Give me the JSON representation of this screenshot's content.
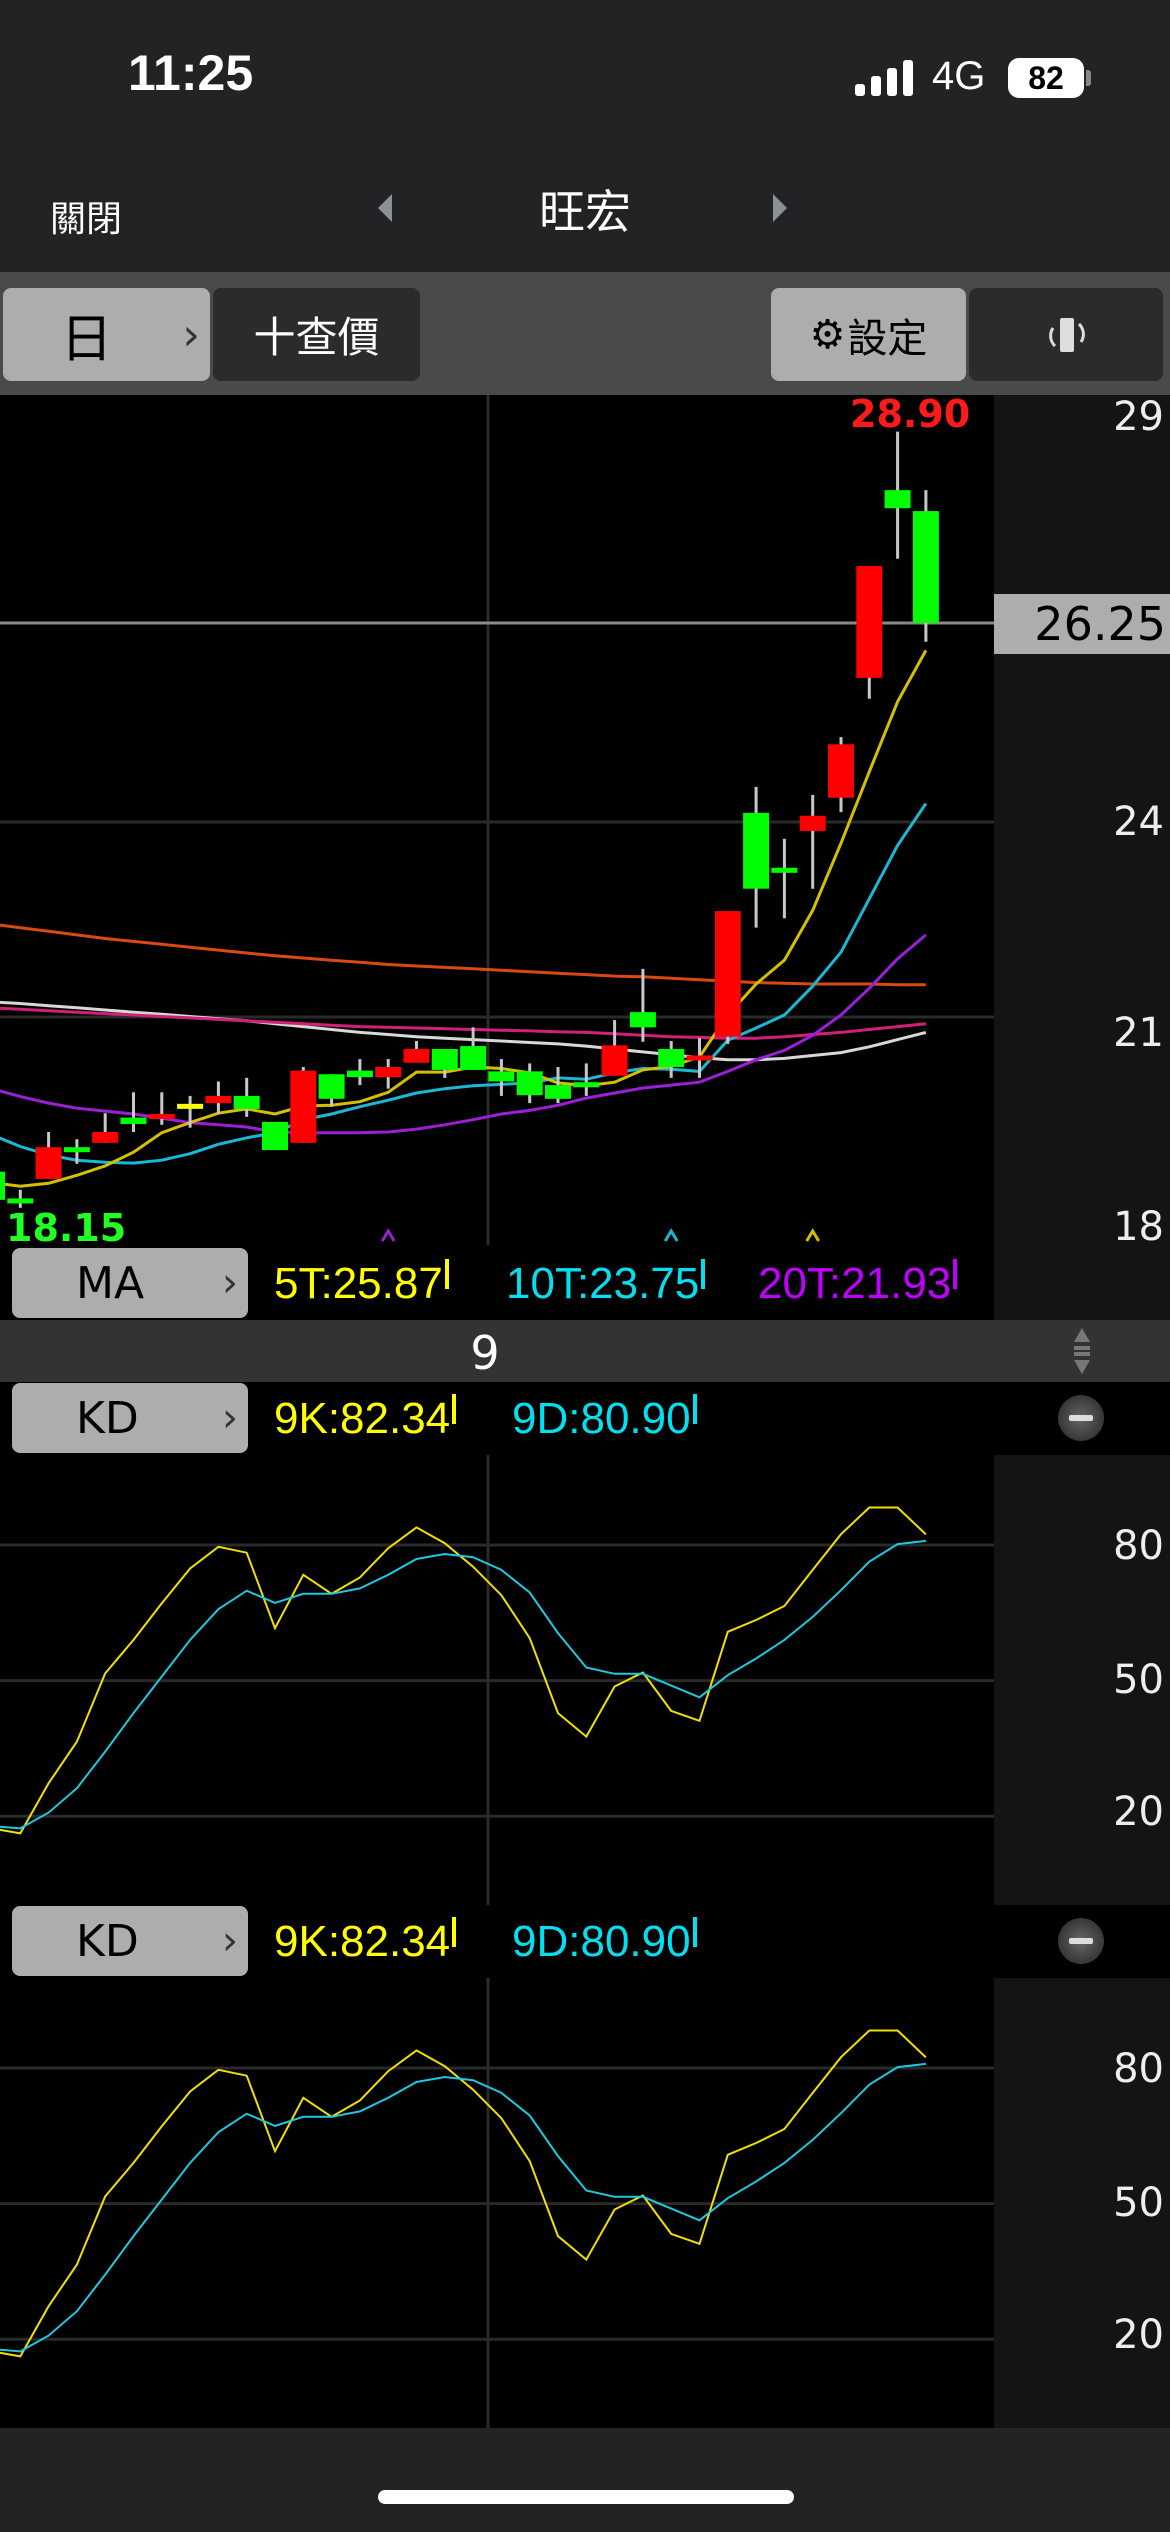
{
  "status_bar": {
    "time": "11:25",
    "network": "4G",
    "battery": "82"
  },
  "nav": {
    "close_label": "關閉",
    "title": "旺宏"
  },
  "toolbar": {
    "period_label": "日",
    "quote_label": "十查價",
    "settings_label": "設定"
  },
  "price_chart": {
    "high_label": "28.90",
    "low_label": "18.15",
    "current_price": "26.25",
    "axis_labels": [
      "29",
      "24",
      "21",
      "18"
    ]
  },
  "ma_row": {
    "button_label": "MA",
    "ma5": "5T:25.87",
    "ma10": "10T:23.75",
    "ma20": "20T:21.93"
  },
  "param_row": {
    "value": "9"
  },
  "kd_rows": [
    {
      "button_label": "KD",
      "k": "9K:82.34",
      "d": "9D:80.90",
      "axis_labels": [
        "80",
        "50",
        "20"
      ]
    },
    {
      "button_label": "KD",
      "k": "9K:82.34",
      "d": "9D:80.90",
      "axis_labels": [
        "80",
        "50",
        "20"
      ]
    }
  ],
  "colors": {
    "up": "#ff0000",
    "down": "#00ff00",
    "flat": "#ffff00",
    "ma5": "#d4c000",
    "ma10": "#1ab8d4",
    "ma20": "#9b1fd6",
    "ma60": "#d0207a",
    "ma120": "#d8d8d8",
    "ma240": "#d84a10",
    "k": "#f0e000",
    "d": "#1ec8e0"
  },
  "chart_data": [
    {
      "type": "candlestick",
      "ohlc": [
        [
          18.65,
          18.7,
          18.2,
          18.26
        ],
        [
          18.28,
          18.4,
          18.15,
          18.26
        ],
        [
          18.55,
          19.2,
          18.55,
          18.99
        ],
        [
          18.99,
          19.1,
          18.76,
          18.97
        ],
        [
          19.05,
          19.46,
          19.05,
          19.2
        ],
        [
          19.4,
          19.75,
          19.2,
          19.31
        ],
        [
          19.41,
          19.75,
          19.3,
          19.45
        ],
        [
          19.59,
          19.7,
          19.26,
          19.59
        ],
        [
          19.6,
          19.9,
          19.45,
          19.7
        ],
        [
          19.7,
          19.95,
          19.41,
          19.52
        ],
        [
          19.34,
          19.34,
          18.95,
          18.95
        ],
        [
          19.05,
          20.1,
          19.05,
          20.05
        ],
        [
          20.0,
          20.0,
          19.55,
          19.66
        ],
        [
          20.05,
          20.21,
          19.85,
          19.96
        ],
        [
          19.96,
          20.21,
          19.8,
          20.1
        ],
        [
          20.16,
          20.46,
          20.16,
          20.35
        ],
        [
          20.35,
          20.35,
          19.95,
          20.06
        ],
        [
          20.39,
          20.65,
          20.06,
          20.06
        ],
        [
          20.04,
          20.21,
          19.7,
          19.9
        ],
        [
          20.04,
          20.15,
          19.6,
          19.71
        ],
        [
          19.85,
          20.1,
          19.6,
          19.66
        ],
        [
          19.89,
          20.15,
          19.7,
          19.82
        ],
        [
          19.98,
          20.75,
          19.98,
          20.4
        ],
        [
          20.86,
          21.46,
          20.45,
          20.65
        ],
        [
          20.35,
          20.46,
          19.95,
          20.1
        ],
        [
          20.2,
          20.5,
          19.95,
          20.26
        ],
        [
          20.52,
          22.26,
          20.42,
          22.26
        ],
        [
          23.62,
          23.98,
          22.03,
          22.57
        ],
        [
          22.86,
          23.26,
          22.16,
          22.79
        ],
        [
          23.37,
          23.87,
          22.57,
          23.58
        ],
        [
          23.83,
          24.67,
          23.63,
          24.57
        ],
        [
          25.49,
          27.04,
          25.2,
          27.04
        ],
        [
          28.09,
          28.9,
          27.14,
          27.84
        ],
        [
          27.8,
          28.09,
          25.99,
          26.25
        ]
      ],
      "ma": {
        "ma5": [
          18.5,
          18.45,
          18.49,
          18.6,
          18.73,
          18.92,
          19.19,
          19.33,
          19.46,
          19.52,
          19.45,
          19.56,
          19.57,
          19.62,
          19.75,
          20.03,
          20.03,
          20.1,
          20.08,
          20.02,
          19.88,
          19.84,
          19.89,
          20.06,
          20.11,
          20.24,
          20.82,
          21.25,
          21.58,
          22.27,
          23.2,
          24.19,
          25.16,
          25.87
        ],
        "ma10": [
          19.16,
          19.0,
          18.88,
          18.81,
          18.78,
          18.77,
          18.81,
          18.9,
          19.03,
          19.12,
          19.19,
          19.37,
          19.45,
          19.55,
          19.64,
          19.74,
          19.8,
          19.84,
          19.86,
          19.88,
          19.95,
          19.93,
          20.02,
          20.08,
          20.07,
          20.04,
          20.47,
          20.64,
          20.82,
          21.22,
          21.69,
          22.43,
          23.17,
          23.75
        ],
        "ma20": [
          19.8,
          19.69,
          19.6,
          19.53,
          19.49,
          19.45,
          19.39,
          19.33,
          19.3,
          19.27,
          19.2,
          19.19,
          19.19,
          19.19,
          19.2,
          19.24,
          19.3,
          19.37,
          19.45,
          19.5,
          19.57,
          19.67,
          19.74,
          19.81,
          19.85,
          19.89,
          20.04,
          20.2,
          20.33,
          20.54,
          20.82,
          21.19,
          21.6,
          21.93
        ],
        "ma60": [
          20.92,
          20.9,
          20.88,
          20.86,
          20.84,
          20.82,
          20.8,
          20.78,
          20.76,
          20.74,
          20.72,
          20.7,
          20.68,
          20.66,
          20.65,
          20.64,
          20.63,
          20.62,
          20.61,
          20.6,
          20.59,
          20.58,
          20.56,
          20.54,
          20.52,
          20.51,
          20.5,
          20.5,
          20.52,
          20.55,
          20.58,
          20.62,
          20.66,
          20.7
        ],
        "ma120": [
          21.0,
          20.98,
          20.95,
          20.92,
          20.89,
          20.86,
          20.83,
          20.8,
          20.77,
          20.74,
          20.7,
          20.66,
          20.62,
          20.58,
          20.55,
          20.52,
          20.5,
          20.48,
          20.46,
          20.44,
          20.42,
          20.39,
          20.35,
          20.31,
          20.27,
          20.23,
          20.2,
          20.2,
          20.22,
          20.26,
          20.3,
          20.38,
          20.48,
          20.58
        ],
        "ma240": [
          22.08,
          22.03,
          21.98,
          21.93,
          21.88,
          21.84,
          21.8,
          21.76,
          21.72,
          21.68,
          21.64,
          21.61,
          21.58,
          21.55,
          21.52,
          21.5,
          21.48,
          21.46,
          21.44,
          21.42,
          21.4,
          21.38,
          21.36,
          21.35,
          21.33,
          21.31,
          21.29,
          21.27,
          21.26,
          21.25,
          21.25,
          21.25,
          21.24,
          21.24
        ]
      },
      "cross_markers": [
        {
          "index": 14,
          "series": "ma20"
        },
        {
          "index": 24,
          "series": "ma10"
        },
        {
          "index": 29,
          "series": "ma5"
        }
      ],
      "ylim": [
        18,
        29
      ]
    },
    {
      "type": "line",
      "title": "KD",
      "series": [
        {
          "name": "9K",
          "values": [
            17.3,
            16.2,
            27.3,
            36.5,
            51.6,
            59.0,
            67.1,
            74.8,
            79.6,
            78.3,
            61.6,
            73.4,
            69.2,
            72.8,
            79.3,
            83.9,
            80.4,
            75.2,
            68.9,
            59.4,
            42.8,
            37.6,
            48.7,
            51.8,
            43.3,
            41.1,
            60.8,
            63.4,
            66.5,
            74.5,
            82.4,
            88.3,
            88.3,
            82.34
          ]
        },
        {
          "name": "9D",
          "values": [
            17.8,
            17.3,
            20.8,
            26.2,
            34.3,
            42.8,
            50.9,
            59.0,
            65.8,
            69.9,
            67.2,
            69.2,
            69.2,
            70.4,
            73.4,
            76.9,
            78.0,
            77.3,
            74.5,
            69.5,
            60.5,
            52.9,
            51.5,
            51.5,
            48.9,
            46.3,
            51.2,
            54.9,
            59.0,
            64.1,
            70.0,
            76.3,
            80.2,
            80.9
          ]
        }
      ],
      "yticks": [
        20,
        50,
        80
      ]
    }
  ]
}
